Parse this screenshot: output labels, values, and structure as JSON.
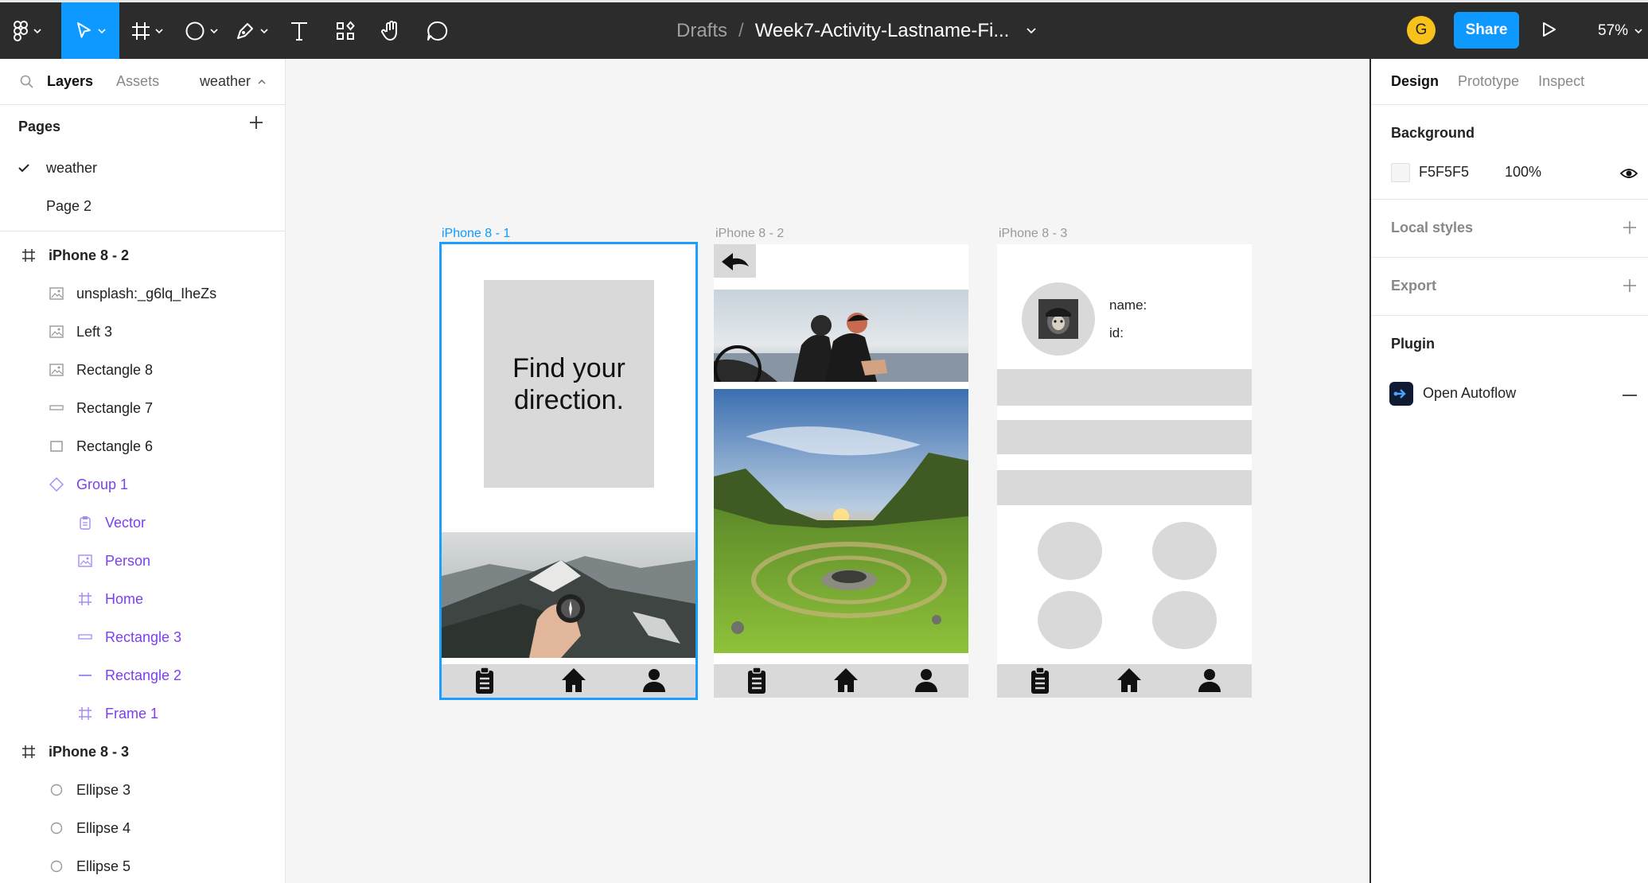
{
  "toolbar": {
    "breadcrumb_root": "Drafts",
    "breadcrumb_sep": "/",
    "file_name": "Week7-Activity-Lastname-Fi...",
    "avatar_initial": "G",
    "share_label": "Share",
    "zoom": "57%",
    "accent": "#0d99ff"
  },
  "left_panel": {
    "tabs": [
      "Layers",
      "Assets"
    ],
    "page_selector": "weather",
    "pages_title": "Pages",
    "pages": [
      {
        "label": "weather",
        "selected": true
      },
      {
        "label": "Page 2",
        "selected": false
      }
    ],
    "layers": [
      {
        "label": "iPhone 8 - 2",
        "icon": "frame-icon",
        "depth": 0,
        "bold": true
      },
      {
        "label": "unsplash:_g6lq_IheZs",
        "icon": "image-icon",
        "depth": 1
      },
      {
        "label": "Left 3",
        "icon": "image-icon",
        "depth": 1
      },
      {
        "label": "Rectangle 8",
        "icon": "image-icon",
        "depth": 1
      },
      {
        "label": "Rectangle 7",
        "icon": "line-rect-icon",
        "depth": 1
      },
      {
        "label": "Rectangle 6",
        "icon": "rectangle-icon",
        "depth": 1
      },
      {
        "label": "Group 1",
        "icon": "component-icon",
        "depth": 1,
        "purple": true
      },
      {
        "label": "Vector",
        "icon": "vector-icon",
        "depth": 2,
        "purple": true
      },
      {
        "label": "Person",
        "icon": "image-icon",
        "depth": 2,
        "purple": true
      },
      {
        "label": "Home",
        "icon": "frame-icon",
        "depth": 2,
        "purple": true
      },
      {
        "label": "Rectangle 3",
        "icon": "line-rect-icon",
        "depth": 2,
        "purple": true
      },
      {
        "label": "Rectangle 2",
        "icon": "line-icon",
        "depth": 2,
        "purple": true
      },
      {
        "label": "Frame 1",
        "icon": "frame-icon",
        "depth": 2,
        "purple": true
      },
      {
        "label": "iPhone 8 - 3",
        "icon": "frame-icon",
        "depth": 0,
        "bold": true
      },
      {
        "label": "Ellipse 3",
        "icon": "ellipse-icon",
        "depth": 1
      },
      {
        "label": "Ellipse 4",
        "icon": "ellipse-icon",
        "depth": 1
      },
      {
        "label": "Ellipse 5",
        "icon": "ellipse-icon",
        "depth": 1
      }
    ]
  },
  "canvas": {
    "frames": [
      {
        "label": "iPhone 8 - 1",
        "heading_line1": "Find your",
        "heading_line2": "direction."
      },
      {
        "label": "iPhone 8 - 2"
      },
      {
        "label": "iPhone 8 - 3",
        "name_label": "name:",
        "id_label": "id:"
      }
    ]
  },
  "right_panel": {
    "tabs": [
      "Design",
      "Prototype",
      "Inspect"
    ],
    "background_title": "Background",
    "background_hex": "F5F5F5",
    "background_opacity": "100%",
    "local_styles": "Local styles",
    "export": "Export",
    "plugin_title": "Plugin",
    "plugin_name": "Open Autoflow"
  }
}
